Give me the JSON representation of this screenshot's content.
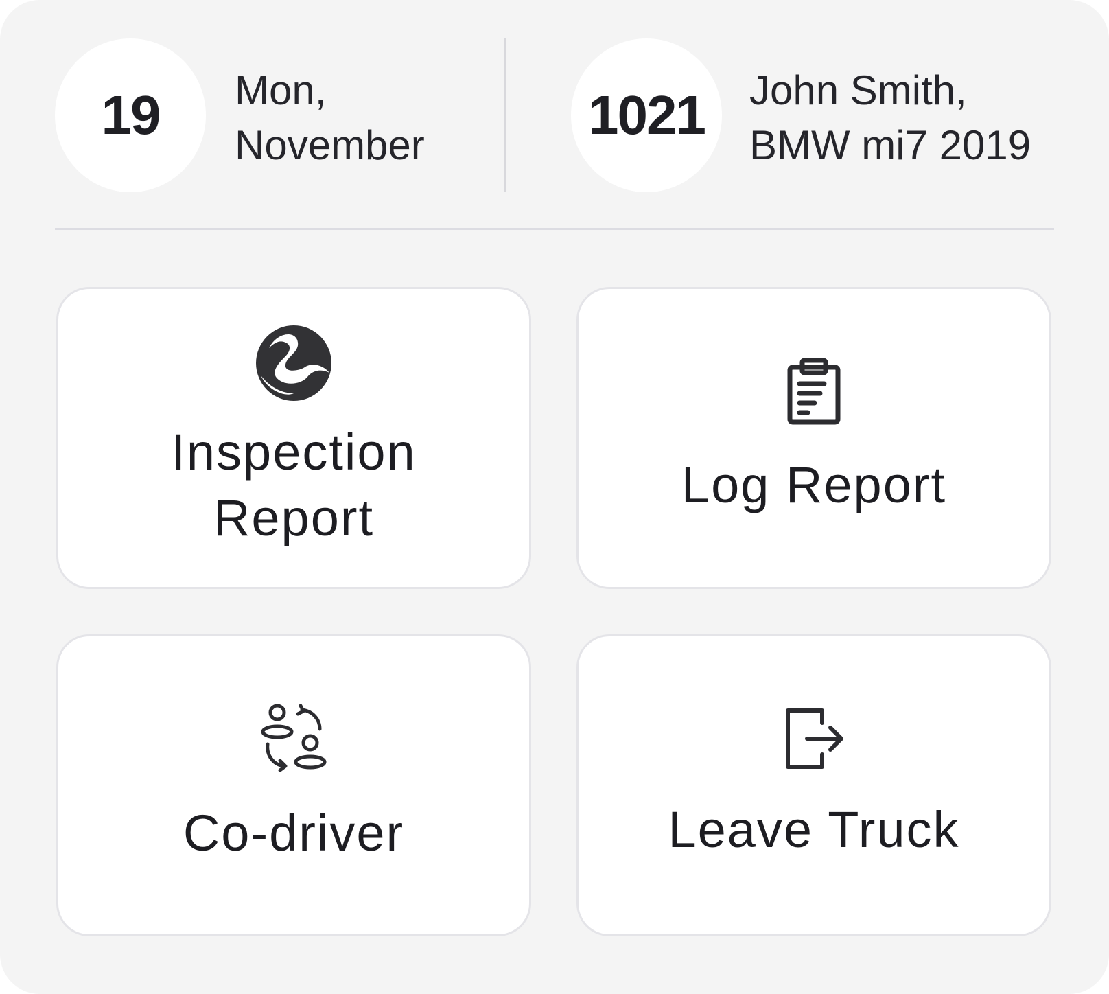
{
  "header": {
    "day_number": "19",
    "day_line1": "Mon,",
    "day_line2": "November",
    "truck_number": "1021",
    "driver_line1": "John Smith,",
    "driver_line2": "BMW mi7 2019"
  },
  "actions": [
    {
      "line1": "Inspection",
      "line2": "Report",
      "icon": "dot-logo-icon"
    },
    {
      "label": "Log Report",
      "icon": "clipboard-icon"
    },
    {
      "label": "Co-driver",
      "icon": "swap-users-icon"
    },
    {
      "label": "Leave Truck",
      "icon": "exit-icon"
    }
  ],
  "colors": {
    "background": "#f4f4f4",
    "card": "#ffffff",
    "text": "#1d1d22",
    "icon": "#2f2f33"
  }
}
